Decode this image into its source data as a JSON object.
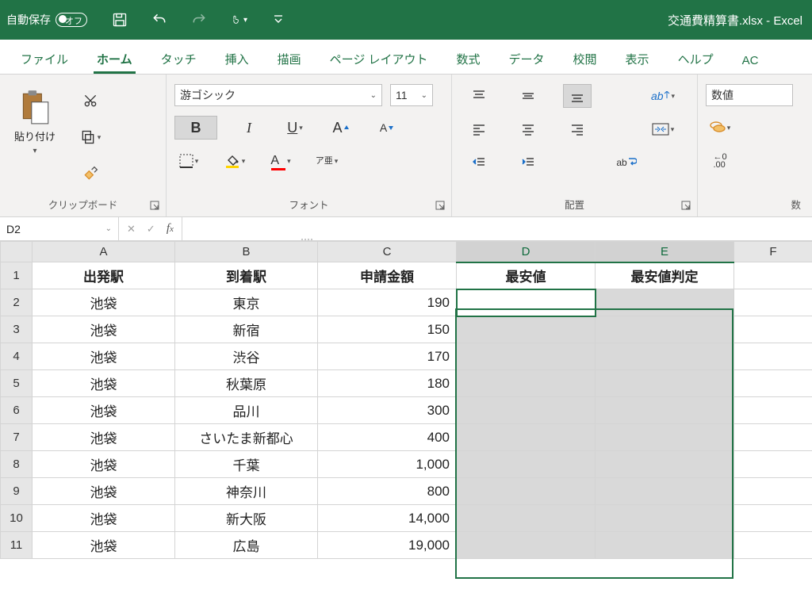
{
  "titlebar": {
    "autosave_label": "自動保存",
    "autosave_state": "オフ",
    "doc_title": "交通費精算書.xlsx  -  Excel"
  },
  "tabs": [
    "ファイル",
    "ホーム",
    "タッチ",
    "挿入",
    "描画",
    "ページ レイアウト",
    "数式",
    "データ",
    "校閲",
    "表示",
    "ヘルプ",
    "AC"
  ],
  "active_tab": 1,
  "ribbon": {
    "clipboard": {
      "paste_label": "貼り付け",
      "group_label": "クリップボード"
    },
    "font": {
      "name": "游ゴシック",
      "size": "11",
      "group_label": "フォント",
      "ruby_button": "ア亜"
    },
    "alignment": {
      "group_label": "配置"
    },
    "number": {
      "format": "数値",
      "group_label": "数"
    }
  },
  "namebox": "D2",
  "columns": [
    "A",
    "B",
    "C",
    "D",
    "E",
    "F"
  ],
  "headers": {
    "A": "出発駅",
    "B": "到着駅",
    "C": "申請金額",
    "D": "最安値",
    "E": "最安値判定"
  },
  "rows": [
    {
      "n": 1
    },
    {
      "n": 2,
      "A": "池袋",
      "B": "東京",
      "C": "190"
    },
    {
      "n": 3,
      "A": "池袋",
      "B": "新宿",
      "C": "150"
    },
    {
      "n": 4,
      "A": "池袋",
      "B": "渋谷",
      "C": "170"
    },
    {
      "n": 5,
      "A": "池袋",
      "B": "秋葉原",
      "C": "180"
    },
    {
      "n": 6,
      "A": "池袋",
      "B": "品川",
      "C": "300"
    },
    {
      "n": 7,
      "A": "池袋",
      "B": "さいたま新都心",
      "C": "400"
    },
    {
      "n": 8,
      "A": "池袋",
      "B": "千葉",
      "C": "1,000"
    },
    {
      "n": 9,
      "A": "池袋",
      "B": "神奈川",
      "C": "800"
    },
    {
      "n": 10,
      "A": "池袋",
      "B": "新大阪",
      "C": "14,000"
    },
    {
      "n": 11,
      "A": "池袋",
      "B": "広島",
      "C": "19,000"
    }
  ]
}
